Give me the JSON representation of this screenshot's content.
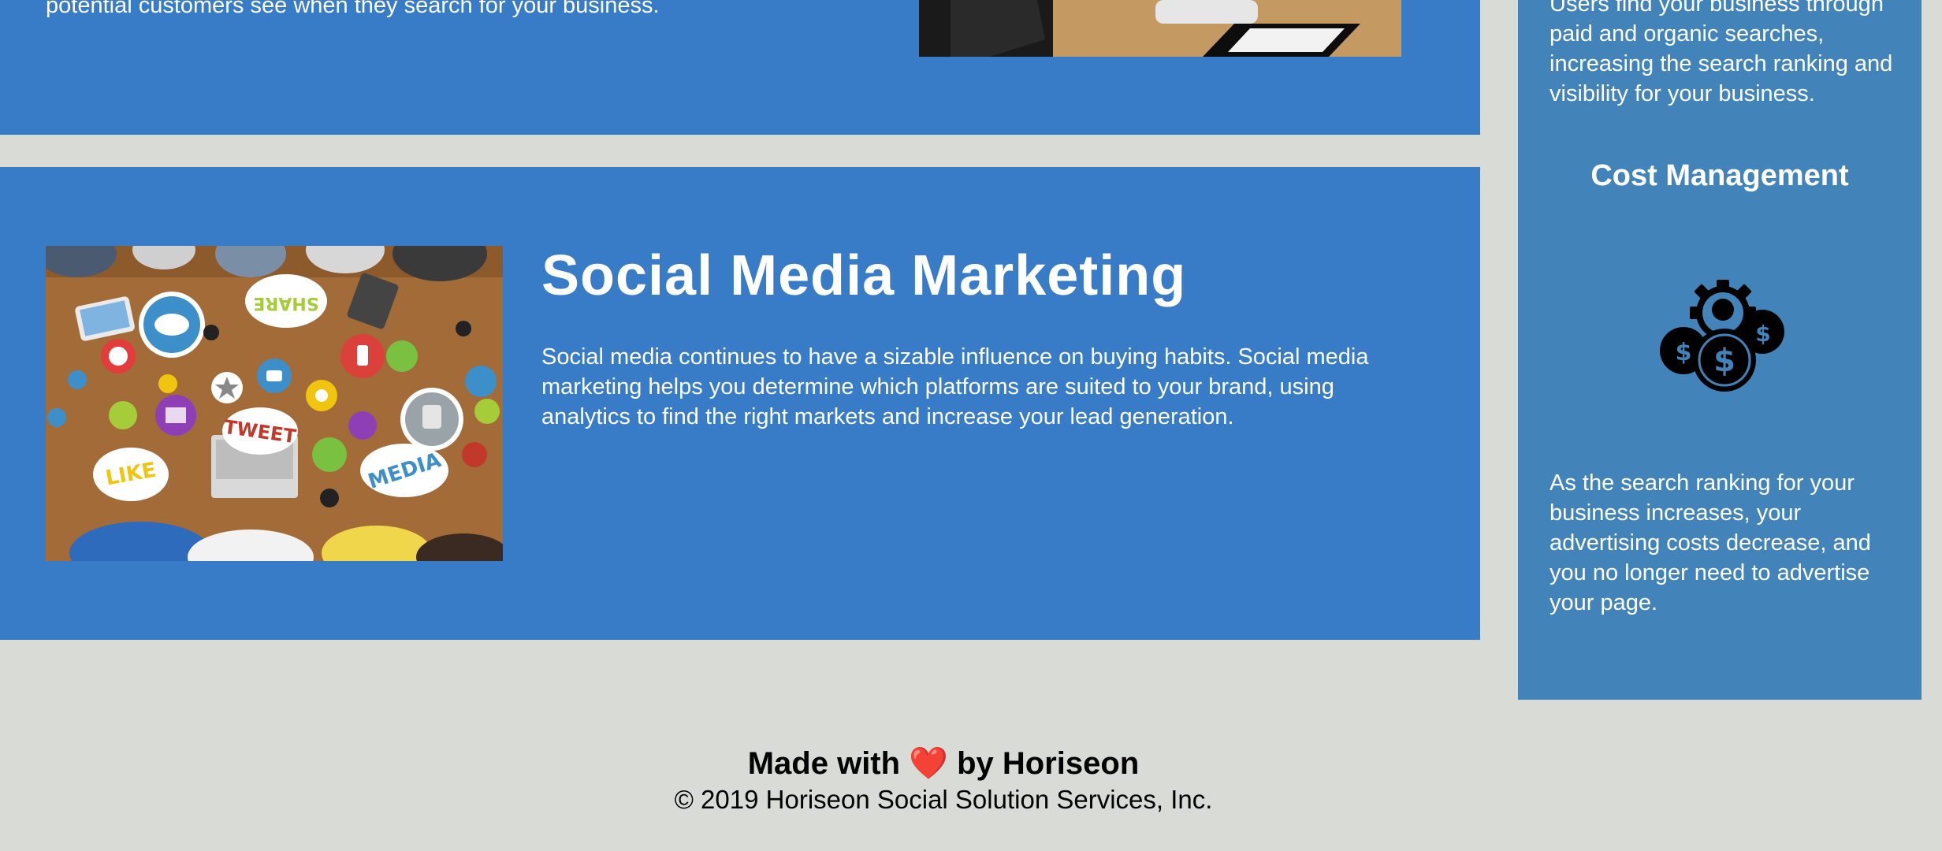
{
  "services": {
    "top_card": {
      "text": "potential customers see when they search for your business."
    },
    "social_media": {
      "title": "Social Media Marketing",
      "text": "Social media continues to have a sizable influence on buying habits. Social media marketing helps you determine which platforms are suited to your brand, using analytics to find the right markets and increase your lead generation.",
      "image_words": {
        "share": "SHARE",
        "tweet": "TWEET",
        "like": "LIKE",
        "media": "MEDIA"
      }
    }
  },
  "sidebar": {
    "top_text": "Users find your business through paid and organic searches, increasing the search ranking and visibility for your business.",
    "cost_heading": "Cost Management",
    "cost_icon": "cost-management-icon",
    "cost_text": "As the search ranking for your business increases, your advertising costs decrease, and you no longer need to advertise your page."
  },
  "footer": {
    "made_with_prefix": "Made with",
    "heart": "❤️",
    "made_with_suffix": "by Horiseon",
    "copyright": "© 2019 Horiseon Social Solution Services, Inc."
  },
  "colors": {
    "page_background": "#d9dcd6",
    "card_background": "#387bc7",
    "sidebar_background": "#4284ba",
    "text_light": "#ffffff",
    "text_dark": "#000000"
  }
}
